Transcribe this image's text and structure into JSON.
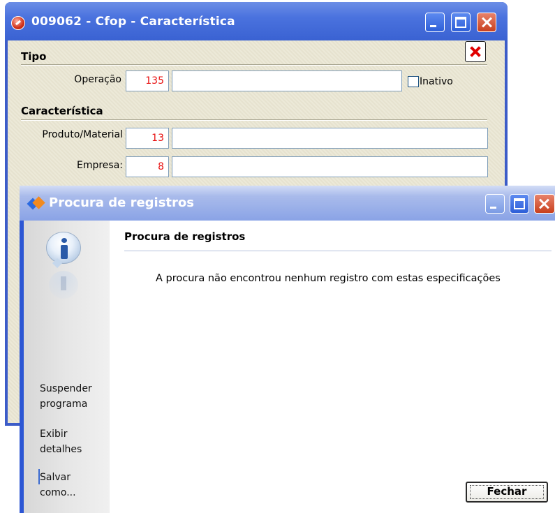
{
  "main_window": {
    "title": "009062 - Cfop - Característica",
    "sections": {
      "tipo": "Tipo",
      "caracteristica": "Característica"
    },
    "fields": {
      "operacao": {
        "label": "Operação",
        "code": "135",
        "description": ""
      },
      "produto_material": {
        "label": "Produto/Material",
        "code": "13",
        "description": ""
      },
      "empresa": {
        "label": "Empresa:",
        "code": "8",
        "description": ""
      }
    },
    "inativo_label": "Inativo",
    "inativo_checked": false,
    "icons": {
      "app": "app-logo-icon",
      "close_record": "red-x-icon"
    }
  },
  "dialog": {
    "title": "Procura de registros",
    "heading": "Procura de registros",
    "message": "A procura não encontrou nenhum registro com estas especificações",
    "sidebar": {
      "suspender": [
        "Suspender",
        "programa"
      ],
      "exibir": [
        "Exibir",
        "detalhes"
      ],
      "salvar": [
        "Salvar",
        "como..."
      ]
    },
    "button_close": "Fechar",
    "icons": {
      "title": "search-app-icon",
      "info": "info-icon"
    }
  },
  "colors": {
    "titlebar_active": "#3a62d2",
    "titlebar_inactive": "#a9bbeb",
    "code_text": "#e81010",
    "window_face": "#ece9d8",
    "close_button": "#c8401e"
  }
}
